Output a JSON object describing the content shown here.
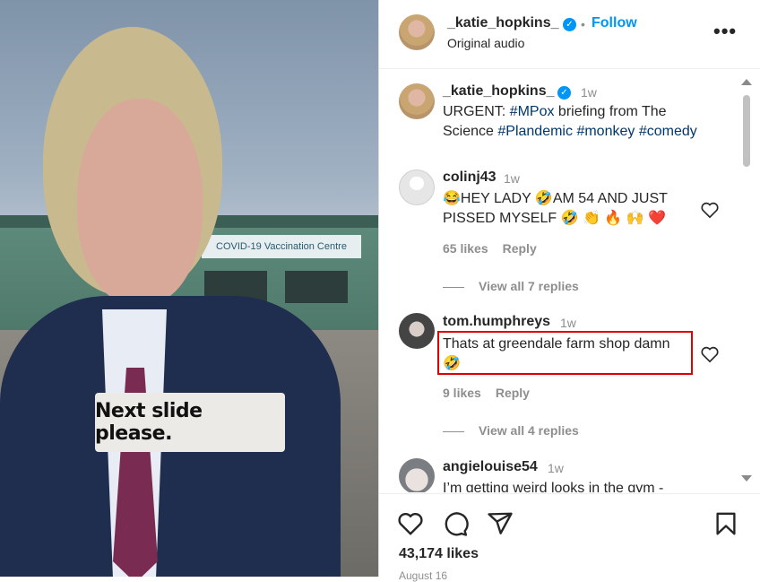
{
  "media": {
    "caption": "Next slide please.",
    "sign_text": "COVID-19 Vaccination Centre"
  },
  "header": {
    "username": "_katie_hopkins_",
    "separator": "•",
    "follow_label": "Follow",
    "audio": "Original audio",
    "more_label": "•••"
  },
  "post": {
    "username": "_katie_hopkins_",
    "time": "1w",
    "caption_parts": [
      "URGENT: ",
      "#MPox",
      " briefing from The",
      "Science ",
      "#Plandemic",
      " ",
      "#monkey",
      " ",
      "#comedy"
    ]
  },
  "comments": [
    {
      "username": "colinj43",
      "time": "1w",
      "line1": "😂HEY LADY 🤣AM 54 AND JUST",
      "line2": "PISSED MYSELF 🤣 👏 🔥 🙌 ❤️",
      "likes": "65 likes",
      "reply_label": "Reply",
      "view_replies": "View all 7 replies"
    },
    {
      "username": "tom.humphreys",
      "time": "1w",
      "line1": "Thats at greendale farm shop damn",
      "line2": "🤣",
      "likes": "9 likes",
      "reply_label": "Reply",
      "view_replies": "View all 4 replies"
    },
    {
      "username": "angielouise54",
      "time": "1w",
      "line1": "I’m getting weird looks in the gym -"
    }
  ],
  "footer": {
    "likes": "43,174 likes",
    "date": "August 16"
  },
  "colors": {
    "accent": "#0095f6",
    "hashtag": "#00376b",
    "highlight": "#e00000"
  },
  "icons": [
    "heart-icon",
    "comment-icon",
    "share-icon",
    "bookmark-icon",
    "verified-icon",
    "more-icon"
  ]
}
